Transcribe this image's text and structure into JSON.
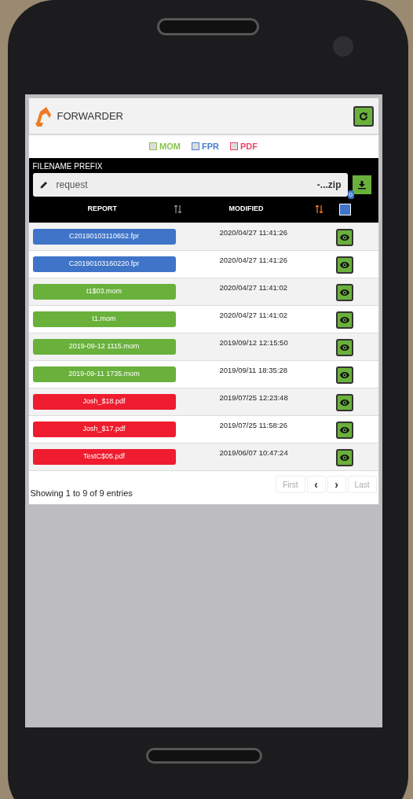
{
  "app": {
    "title": "FORWARDER"
  },
  "filters": [
    {
      "label": "MOM",
      "color": "#8bc34a",
      "checked": false
    },
    {
      "label": "FPR",
      "color": "#4a7fd0",
      "checked": false
    },
    {
      "label": "PDF",
      "color": "#f0446a",
      "checked": false
    }
  ],
  "prefix": {
    "label": "FILENAME PREFIX",
    "value": "request",
    "suffix": "-...zip",
    "badge": "0"
  },
  "table": {
    "columns": [
      {
        "label": "REPORT",
        "sort_active": false
      },
      {
        "label": "MODIFIED",
        "sort_active": true
      }
    ],
    "select_all": {
      "checked": false
    },
    "rows": [
      {
        "report": "C20190103110652.fpr",
        "modified": "2020/04/27 11:41:26",
        "color": "#3f74c9"
      },
      {
        "report": "C20190103160220.fpr",
        "modified": "2020/04/27 11:41:26",
        "color": "#3f74c9"
      },
      {
        "report": "t1$03.mom",
        "modified": "2020/04/27 11:41:02",
        "color": "#6ab13c"
      },
      {
        "report": "t1.mom",
        "modified": "2020/04/27 11:41:02",
        "color": "#6ab13c"
      },
      {
        "report": "2019-09-12 1115.mom",
        "modified": "2019/09/12 12:15:50",
        "color": "#6ab13c"
      },
      {
        "report": "2019-09-11 1735.mom",
        "modified": "2019/09/11 18:35:28",
        "color": "#6ab13c"
      },
      {
        "report": "Josh_$18.pdf",
        "modified": "2019/07/25 12:23:48",
        "color": "#ee1c2e"
      },
      {
        "report": "Josh_$17.pdf",
        "modified": "2019/07/25 11:58:26",
        "color": "#ee1c2e"
      },
      {
        "report": "TestC$05.pdf",
        "modified": "2019/06/07 10:47:24",
        "color": "#ee1c2e"
      }
    ]
  },
  "footer": {
    "info": "Showing 1 to 9 of 9 entries",
    "pages": [
      {
        "label": "First",
        "kind": "text",
        "disabled": true
      },
      {
        "label": "‹",
        "kind": "arrow",
        "disabled": false
      },
      {
        "label": "›",
        "kind": "arrow",
        "disabled": false
      },
      {
        "label": "Last",
        "kind": "text",
        "disabled": true
      }
    ]
  }
}
